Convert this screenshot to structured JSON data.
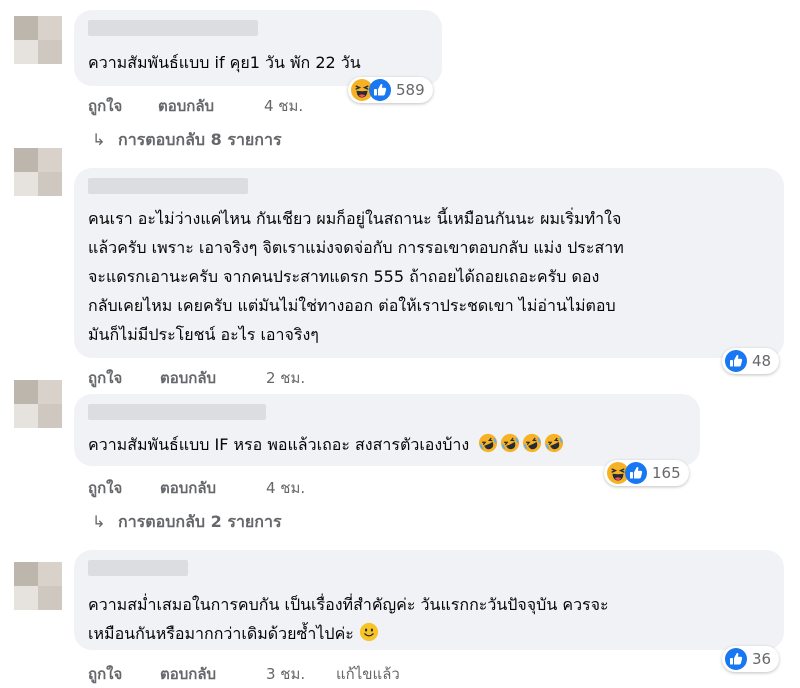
{
  "comments": [
    {
      "text_lines": [
        "ความสัมพันธ์แบบ if คุย1 วัน พัก 22 วัน"
      ],
      "like_label": "ถูกใจ",
      "reply_label": "ตอบกลับ",
      "time": "4 ชม.",
      "reaction_count": "589",
      "reaction_icons": [
        "haha-icon",
        "like-icon"
      ],
      "replies_label": "การตอบกลับ 8 รายการ"
    },
    {
      "text_lines": [
        "คนเรา อะไม่ว่างแค่ไหน กันเชียว ผมก็อยู่ในสถานะ นี้เหมือนกันนะ ผมเริ่มทำใจ",
        "แล้วครับ เพราะ เอาจริงๆ จิตเราแม่งจดจ่อกับ การรอเขาตอบกลับ แม่ง ประสาท",
        "จะแดรกเอานะครับ จากคนประสาทแดรก 555 ถ้าถอยได้ถอยเถอะครับ ดอง",
        "กลับเคยไหม เคยครับ แต่มันไม่ใช่ทางออก ต่อให้เราประชดเขา ไม่อ่านไม่ตอบ",
        "มันก็ไม่มีประโยชน์ อะไร เอาจริงๆ"
      ],
      "like_label": "ถูกใจ",
      "reply_label": "ตอบกลับ",
      "time": "2 ชม.",
      "reaction_count": "48",
      "reaction_icons": [
        "like-icon"
      ]
    },
    {
      "text_lines": [
        "ความสัมพันธ์แบบ IF หรอ พอแล้วเถอะ สงสารตัวเองบ้าง"
      ],
      "trailing_emoji": [
        "rofl-emoji",
        "rofl-emoji",
        "rofl-emoji",
        "rofl-emoji"
      ],
      "like_label": "ถูกใจ",
      "reply_label": "ตอบกลับ",
      "time": "4 ชม.",
      "reaction_count": "165",
      "reaction_icons": [
        "haha-icon",
        "like-icon"
      ],
      "replies_label": "การตอบกลับ 2 รายการ"
    },
    {
      "text_lines": [
        "ความสม่ำเสมอในการคบกัน เป็นเรื่องที่สำคัญค่ะ วันแรกกะวันปัจจุบัน ควรจะ",
        "เหมือนกันหรือมากกว่าเดิมด้วยซ้ำไปค่ะ"
      ],
      "trailing_emoji": [
        "smile-emoji"
      ],
      "like_label": "ถูกใจ",
      "reply_label": "ตอบกลับ",
      "time": "3 ชม.",
      "edited_label": "แก้ไขแล้ว",
      "reaction_count": "36",
      "reaction_icons": [
        "like-icon"
      ]
    }
  ],
  "colors": {
    "bubble": "#f0f2f5",
    "meta_text": "#65676b",
    "like_blue": "#1877f2",
    "haha_yellow": "#f7b125"
  }
}
